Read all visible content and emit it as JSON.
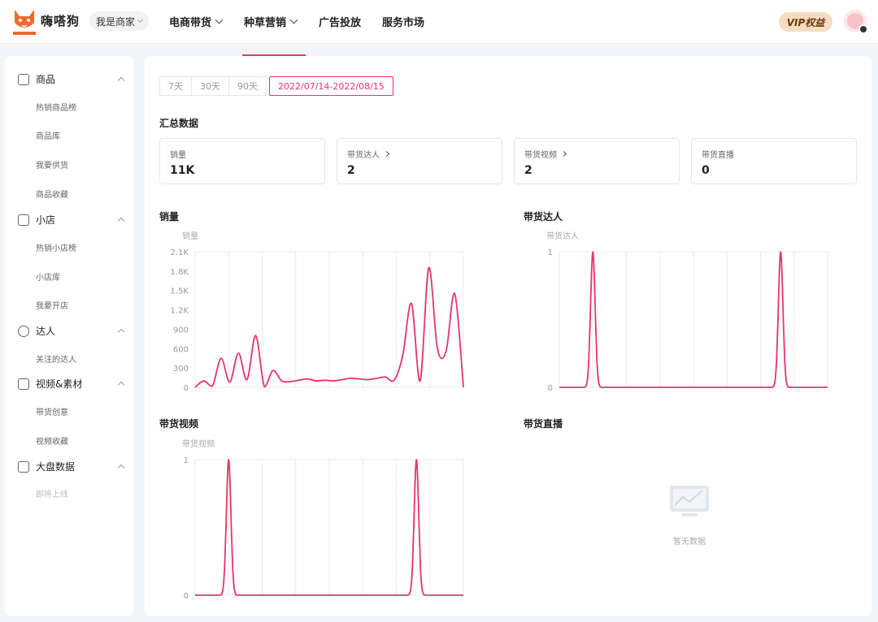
{
  "header": {
    "logo_text": "嗨嗒狗",
    "role": "我是商家",
    "nav": [
      "电商带货",
      "种草营销",
      "广告投放",
      "服务市场"
    ],
    "vip": "VIP权益"
  },
  "sidebar": {
    "groups": [
      {
        "label": "商品",
        "icon": "bag-icon",
        "items": [
          "热销商品榜",
          "商品库",
          "我要供货",
          "商品收藏"
        ]
      },
      {
        "label": "小店",
        "icon": "shop-icon",
        "items": [
          "热销小店榜",
          "小店库",
          "我要开店"
        ]
      },
      {
        "label": "达人",
        "icon": "star-icon",
        "items": [
          "关注的达人"
        ]
      },
      {
        "label": "视频&素材",
        "icon": "video-icon",
        "items": [
          "带货创意",
          "视频收藏"
        ]
      },
      {
        "label": "大盘数据",
        "icon": "dashboard-icon",
        "items": [
          "即将上线"
        ]
      }
    ]
  },
  "range": {
    "options": [
      "7天",
      "30天",
      "90天"
    ],
    "selected": "2022/07/14-2022/08/15"
  },
  "summary": {
    "title": "汇总数据",
    "cards": [
      {
        "label": "销量",
        "value": "11K",
        "link": false
      },
      {
        "label": "带货达人",
        "value": "2",
        "link": true
      },
      {
        "label": "带货视频",
        "value": "2",
        "link": true
      },
      {
        "label": "带货直播",
        "value": "0",
        "link": false
      }
    ]
  },
  "charts": {
    "sales_title": "销量",
    "creators_title": "带货达人",
    "videos_title": "带货视频",
    "live_title": "带货直播",
    "live_empty": "暂无数据"
  },
  "chart_data": [
    {
      "type": "line",
      "series_label": "销量",
      "y_ticks": [
        "0",
        "300",
        "600",
        "900",
        "1.2K",
        "1.5K",
        "1.8K",
        "2.1K"
      ],
      "ylim": [
        0,
        2100
      ],
      "values": [
        0,
        100,
        20,
        450,
        80,
        530,
        120,
        800,
        10,
        260,
        100,
        90,
        110,
        130,
        100,
        110,
        100,
        120,
        140,
        130,
        120,
        140,
        160,
        110,
        500,
        1300,
        100,
        1850,
        600,
        560,
        1450,
        0
      ],
      "color": "#e8336b"
    },
    {
      "type": "line",
      "series_label": "带货达人",
      "y_ticks": [
        "0",
        "1"
      ],
      "ylim": [
        0,
        1
      ],
      "spikes": [
        0.125,
        0.825
      ],
      "color": "#e8336b"
    },
    {
      "type": "line",
      "series_label": "带货视频",
      "y_ticks": [
        "0",
        "1"
      ],
      "ylim": [
        0,
        1
      ],
      "spikes": [
        0.125,
        0.825
      ],
      "color": "#e8336b"
    }
  ]
}
